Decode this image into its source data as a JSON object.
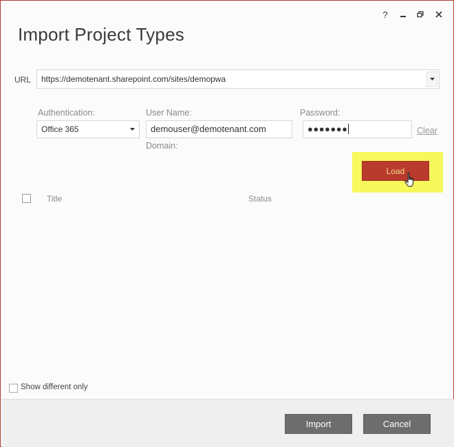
{
  "window": {
    "title": "Import Project Types",
    "help_label": "?",
    "controls": [
      "help-icon",
      "minimize-icon",
      "restore-icon",
      "close-icon"
    ]
  },
  "url": {
    "label": "URL",
    "value": "https://demotenant.sharepoint.com/sites/demopwa"
  },
  "auth": {
    "label": "Authentication:",
    "value": "Office 365"
  },
  "username": {
    "label": "User Name:",
    "value": "demouser@demotenant.com"
  },
  "domain": {
    "label": "Domain:"
  },
  "password": {
    "label": "Password:",
    "masked": "●●●●●●●",
    "clear_label": "Clear"
  },
  "load": {
    "label": "Load",
    "highlight_color": "#f7f85c",
    "button_color": "#b83b2e"
  },
  "list": {
    "columns": [
      "Title",
      "Status"
    ]
  },
  "options": {
    "show_different_label": "Show different only"
  },
  "footer": {
    "import_label": "Import",
    "cancel_label": "Cancel"
  }
}
